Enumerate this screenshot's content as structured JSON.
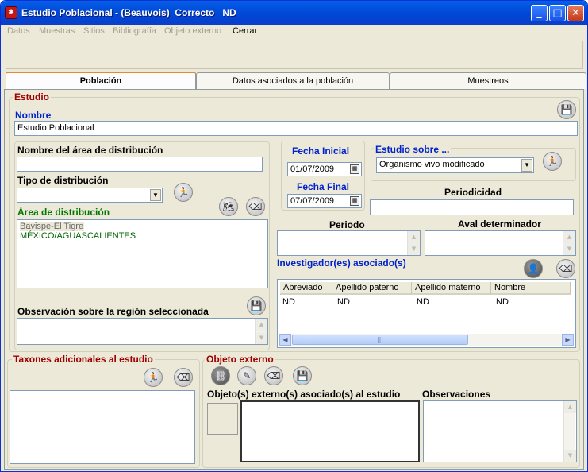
{
  "window": {
    "title": "Estudio Poblacional - (Beauvois)  Correcto   ND",
    "buttons": {
      "minimize": "_",
      "maximize": "□",
      "close": "✕"
    }
  },
  "menu": [
    {
      "label": "Datos",
      "enabled": false
    },
    {
      "label": "Muestras",
      "enabled": false
    },
    {
      "label": "Sitios",
      "enabled": false
    },
    {
      "label": "Bibliografía",
      "enabled": false
    },
    {
      "label": "Objeto externo",
      "enabled": false
    },
    {
      "label": "Cerrar",
      "enabled": true
    }
  ],
  "tabs": [
    {
      "label": "Población",
      "active": true
    },
    {
      "label": "Datos asociados a la población",
      "active": false
    },
    {
      "label": "Muestreos",
      "active": false
    }
  ],
  "estudio": {
    "legend": "Estudio",
    "nombre_label": "Nombre",
    "nombre_value": "Estudio Poblacional",
    "area_nombre_label": "Nombre del área de distribución",
    "area_nombre_value": "",
    "tipo_label": "Tipo de distribución",
    "tipo_value": "",
    "area_label": "Área de distribución",
    "area_items": [
      "Bavispe-El Tigre",
      "MÉXICO/AGUASCALIENTES"
    ],
    "observacion_label": "Observación sobre la región seleccionada",
    "observacion_value": "",
    "fecha_inicial_label": "Fecha Inicial",
    "fecha_inicial_value": "01/07/2009",
    "fecha_final_label": "Fecha Final",
    "fecha_final_value": "07/07/2009",
    "estudio_sobre_label": "Estudio sobre ...",
    "estudio_sobre_value": "Organismo vivo modificado",
    "periodicidad_label": "Periodicidad",
    "periodicidad_value": "",
    "periodo_label": "Periodo",
    "aval_label": "Aval determinador",
    "investigadores_label": "Investigador(es) asociado(s)",
    "grid_headers": [
      "Abreviado",
      "Apellido paterno",
      "Apellido materno",
      "Nombre"
    ],
    "grid_rows": [
      [
        "ND",
        "ND",
        "ND",
        "ND"
      ]
    ]
  },
  "taxones": {
    "legend": "Taxones adicionales al estudio"
  },
  "objeto": {
    "legend": "Objeto externo",
    "asociados_label": "Objeto(s) externo(s) asociado(s) al estudio",
    "observaciones_label": "Observaciones"
  },
  "icons": {
    "app": "bug-icon",
    "save": "floppy-disk-icon",
    "eraser": "eraser-icon",
    "edit_person": "running-person-icon",
    "map": "map-link-icon",
    "add_user": "add-user-icon"
  }
}
